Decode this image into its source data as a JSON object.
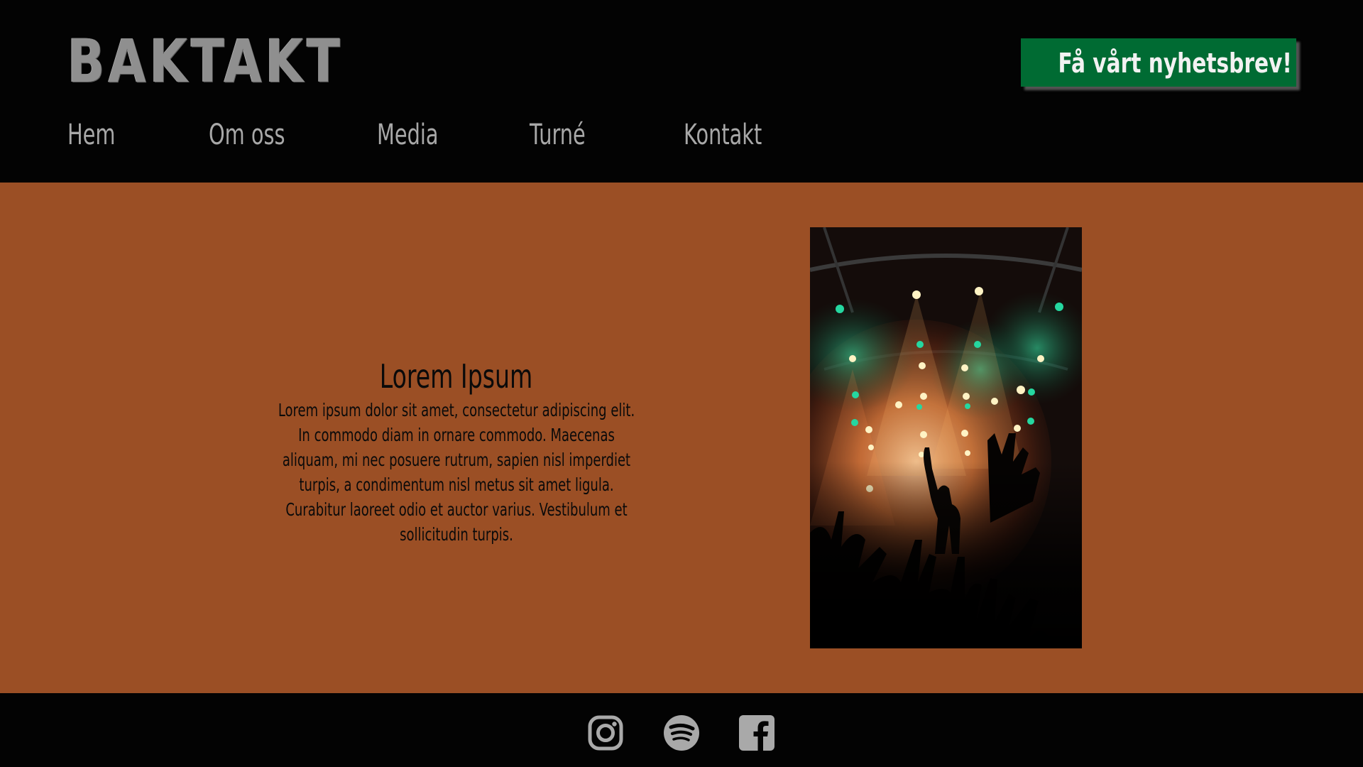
{
  "header": {
    "logo_text": "BAKTAKT",
    "newsletter_button": "Få vårt nyhetsbrev!",
    "nav": [
      {
        "label": "Hem"
      },
      {
        "label": "Om oss"
      },
      {
        "label": "Media"
      },
      {
        "label": "Turné"
      },
      {
        "label": "Kontakt"
      }
    ]
  },
  "main": {
    "title": "Lorem Ipsum",
    "body": "Lorem ipsum dolor sit amet, consectetur adipiscing elit. In commodo diam in ornare commodo. Maecenas aliquam, mi nec posuere rutrum, sapien nisl imperdiet turpis, a condimentum nisl metus sit amet ligula. Curabitur laoreet odio et auctor varius. Vestibulum et sollicitudin turpis.",
    "image": "concert-photo"
  },
  "footer": {
    "social": [
      {
        "icon": "instagram-icon"
      },
      {
        "icon": "spotify-icon"
      },
      {
        "icon": "facebook-icon"
      }
    ]
  },
  "colors": {
    "header_bg": "#030303",
    "main_bg": "#9b4f25",
    "accent_green": "#006b33",
    "nav_text": "#a8a8a8",
    "icon_gray": "#a9a9a9"
  }
}
